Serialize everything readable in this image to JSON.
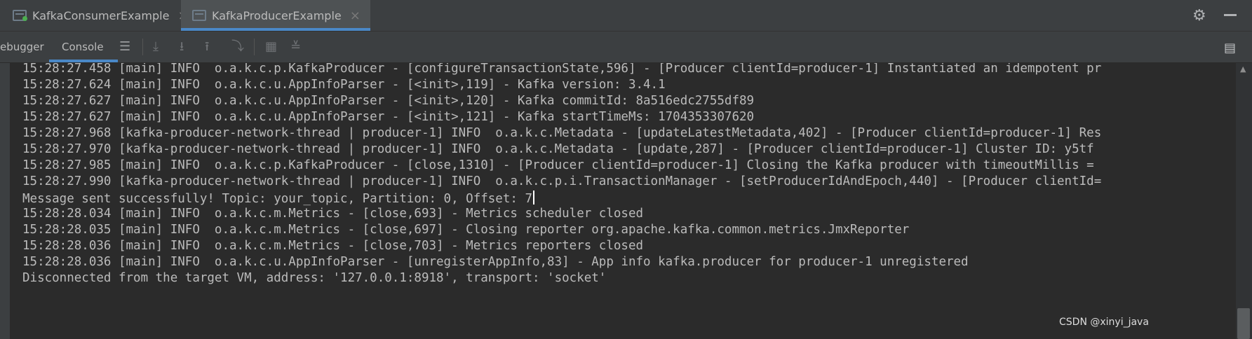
{
  "tabs": [
    {
      "label": "KafkaConsumerExample",
      "close": "×"
    },
    {
      "label": "KafkaProducerExample",
      "close": "×"
    }
  ],
  "toolbar": {
    "debugger_label": "ebugger",
    "console_label": "Console"
  },
  "icons": {
    "gear": "⚙",
    "menu": "☰",
    "scroll_end": "⤓",
    "download": "⭳",
    "upload": "⭱",
    "step": "⤵",
    "table": "▦",
    "settings": "≚",
    "layout": "▤",
    "scroll_up": "▲"
  },
  "console": {
    "lines": [
      "15:28:27.458 [main] INFO  o.a.k.c.p.KafkaProducer - [configureTransactionState,596] - [Producer clientId=producer-1] Instantiated an idempotent pr",
      "15:28:27.624 [main] INFO  o.a.k.c.u.AppInfoParser - [<init>,119] - Kafka version: 3.4.1",
      "15:28:27.627 [main] INFO  o.a.k.c.u.AppInfoParser - [<init>,120] - Kafka commitId: 8a516edc2755df89",
      "15:28:27.627 [main] INFO  o.a.k.c.u.AppInfoParser - [<init>,121] - Kafka startTimeMs: 1704353307620",
      "15:28:27.968 [kafka-producer-network-thread | producer-1] INFO  o.a.k.c.Metadata - [updateLatestMetadata,402] - [Producer clientId=producer-1] Res",
      "15:28:27.970 [kafka-producer-network-thread | producer-1] INFO  o.a.k.c.Metadata - [update,287] - [Producer clientId=producer-1] Cluster ID: y5tf",
      "15:28:27.985 [main] INFO  o.a.k.c.p.KafkaProducer - [close,1310] - [Producer clientId=producer-1] Closing the Kafka producer with timeoutMillis =",
      "15:28:27.990 [kafka-producer-network-thread | producer-1] INFO  o.a.k.c.p.i.TransactionManager - [setProducerIdAndEpoch,440] - [Producer clientId=",
      "Message sent successfully! Topic: your_topic, Partition: 0, Offset: 7",
      "15:28:28.034 [main] INFO  o.a.k.c.m.Metrics - [close,693] - Metrics scheduler closed",
      "15:28:28.035 [main] INFO  o.a.k.c.m.Metrics - [close,697] - Closing reporter org.apache.kafka.common.metrics.JmxReporter",
      "15:28:28.036 [main] INFO  o.a.k.c.m.Metrics - [close,703] - Metrics reporters closed",
      "15:28:28.036 [main] INFO  o.a.k.c.u.AppInfoParser - [unregisterAppInfo,83] - App info kafka.producer for producer-1 unregistered",
      "Disconnected from the target VM, address: '127.0.0.1:8918', transport: 'socket'"
    ]
  },
  "watermark": "CSDN @xinyi_java"
}
